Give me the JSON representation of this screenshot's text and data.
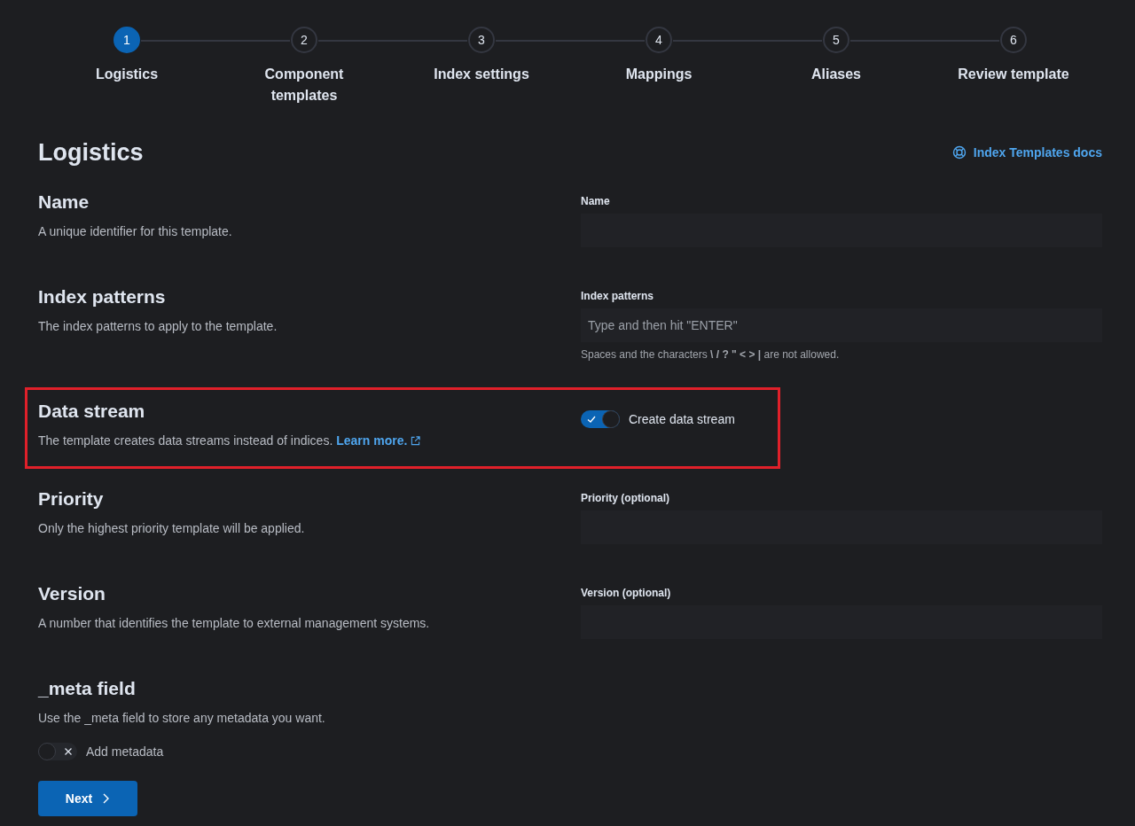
{
  "steps": [
    {
      "number": "1",
      "label": "Logistics",
      "selected": true
    },
    {
      "number": "2",
      "label": "Component templates",
      "selected": false
    },
    {
      "number": "3",
      "label": "Index settings",
      "selected": false
    },
    {
      "number": "4",
      "label": "Mappings",
      "selected": false
    },
    {
      "number": "5",
      "label": "Aliases",
      "selected": false
    },
    {
      "number": "6",
      "label": "Review template",
      "selected": false
    }
  ],
  "page": {
    "title": "Logistics",
    "docs_link": "Index Templates docs"
  },
  "sections": [
    {
      "title": "Name",
      "description": "A unique identifier for this template.",
      "highlighted": false,
      "control": {
        "kind": "text",
        "label": "Name"
      }
    },
    {
      "title": "Index patterns",
      "description": "The index patterns to apply to the template.",
      "highlighted": false,
      "control": {
        "kind": "text",
        "label": "Index patterns",
        "placeholder": "Type and then hit \"ENTER\"",
        "help": "Spaces and the characters **\\ / ? \" < > |** are not allowed."
      }
    },
    {
      "title": "Data stream",
      "description": "The template creates data streams instead of indices.",
      "link": "Learn more.",
      "highlighted": true,
      "control": {
        "kind": "toggle",
        "label": "Create data stream",
        "checked": true
      }
    },
    {
      "title": "Priority",
      "description": "Only the highest priority template will be applied.",
      "highlighted": false,
      "control": {
        "kind": "text",
        "label": "Priority (optional)"
      }
    },
    {
      "title": "Version",
      "description": "A number that identifies the template to external management systems.",
      "highlighted": false,
      "control": {
        "kind": "text",
        "label": "Version (optional)"
      }
    },
    {
      "title": "_meta field",
      "description": "Use the _meta field to store any metadata you want.",
      "highlighted": false,
      "toggle": {
        "label": "Add metadata",
        "checked": false
      }
    }
  ],
  "next_button": "Next"
}
